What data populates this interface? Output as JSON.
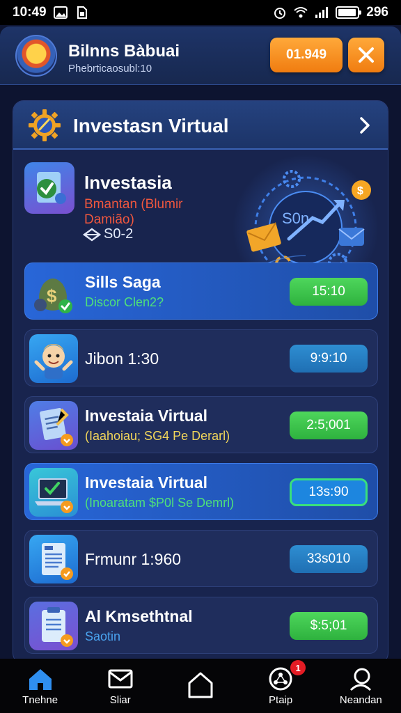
{
  "status_bar": {
    "time": "10:49",
    "battery": "296"
  },
  "header": {
    "title": "Bilnns Bàbuai",
    "subtitle": "Phebrticaosubl:10",
    "balance_button": "01.949",
    "close_label": "✕"
  },
  "panel": {
    "title": "Investasn Virtual",
    "featured": {
      "title": "Investasia",
      "subtitle": "Bmantan (Blumir Damião)",
      "meta": "S0-2",
      "art_text": "S0n"
    },
    "rows": [
      {
        "title": "Sills Saga",
        "subtitle": "Discor Clen2?",
        "value": "15:10",
        "subtitle_color": "#4fe07a",
        "pill": "green",
        "active": true,
        "icon": "money-bag-icon"
      },
      {
        "title": "Jibon 1:30",
        "subtitle": "",
        "value": "9:9:10",
        "pill": "blue",
        "active": false,
        "icon": "mascot-icon"
      },
      {
        "title": "Investaia Virtual",
        "subtitle": "(Iaahoiau; SG4 Pe Derarl)",
        "value": "2:5;001",
        "subtitle_color": "#f2d65a",
        "pill": "green",
        "active": false,
        "icon": "document-icon"
      },
      {
        "title": "Investaia Virtual",
        "subtitle": "(Inoaratam $P0l Se Demrl)",
        "value": "13s:90",
        "subtitle_color": "#4fe07a",
        "pill": "outline",
        "active": true,
        "icon": "laptop-icon"
      },
      {
        "title": "Frmunr 1:960",
        "subtitle": "",
        "value": "33s010",
        "pill": "blue",
        "active": false,
        "icon": "report-icon"
      },
      {
        "title": "Al Kmsethtnal",
        "subtitle": "Saotin",
        "value": "$:5;01",
        "subtitle_color": "#4aa4f0",
        "pill": "green",
        "active": false,
        "icon": "clipboard-icon"
      }
    ]
  },
  "bottom_nav": [
    {
      "label": "Tnehne",
      "icon": "home-icon"
    },
    {
      "label": "Sliar",
      "icon": "mail-icon"
    },
    {
      "label": "",
      "icon": "house-outline-icon"
    },
    {
      "label": "Ptaip",
      "icon": "network-icon",
      "badge": "1"
    },
    {
      "label": "Neandan",
      "icon": "profile-icon"
    }
  ],
  "colors": {
    "accent_orange": "#f58a1f",
    "success_green": "#3ec94d",
    "primary_blue": "#2866d8",
    "background": "#0d1430"
  }
}
